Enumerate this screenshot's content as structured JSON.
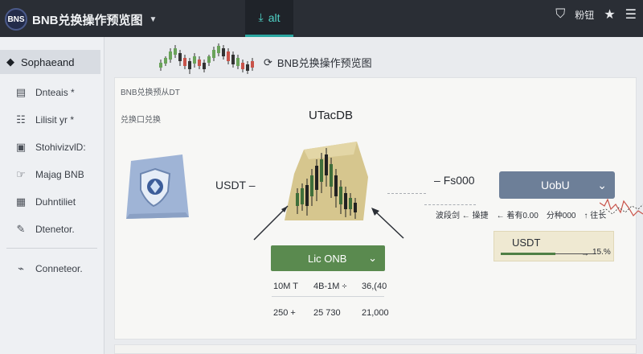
{
  "app": {
    "logo_text": "BNS",
    "title": "BNB兑换操作预览图",
    "tab_label": "alt",
    "top_right_label": "粉钮"
  },
  "sidebar": {
    "header": "Sophaeand",
    "items": [
      {
        "label": "Dnteais *",
        "icon": "doc-icon"
      },
      {
        "label": "Lilisit yr *",
        "icon": "list-icon"
      },
      {
        "label": "StohivizvlD:",
        "icon": "image-icon"
      },
      {
        "label": "Majag BNB",
        "icon": "hand-icon"
      },
      {
        "label": "Duhntiliet",
        "icon": "calendar-icon"
      },
      {
        "label": "Dtenetor.",
        "icon": "edit-icon"
      }
    ],
    "footer_item": {
      "label": "Conneteor.",
      "icon": "connect-icon"
    }
  },
  "main": {
    "header_title": "BNB兑换操作预览图",
    "sub1": "BNB兑换预从DT",
    "sub2": "兑换口兑换",
    "center_label": "UTacDB",
    "left_token": "USDT",
    "right_value": "Fs000",
    "right_select": "UobU",
    "swap_select": "Lic ONB",
    "stats": [
      "波段剑 ← 操捷",
      "← 着有0.00",
      "分种000",
      "↑ 往长"
    ],
    "usdt_card": {
      "label": "USDT",
      "pct": "15.%"
    },
    "table": {
      "row1": [
        "10M T",
        "4B-1M ÷",
        "36,(40"
      ],
      "row2": [
        "250 +",
        "25   730",
        "21,000"
      ]
    }
  }
}
